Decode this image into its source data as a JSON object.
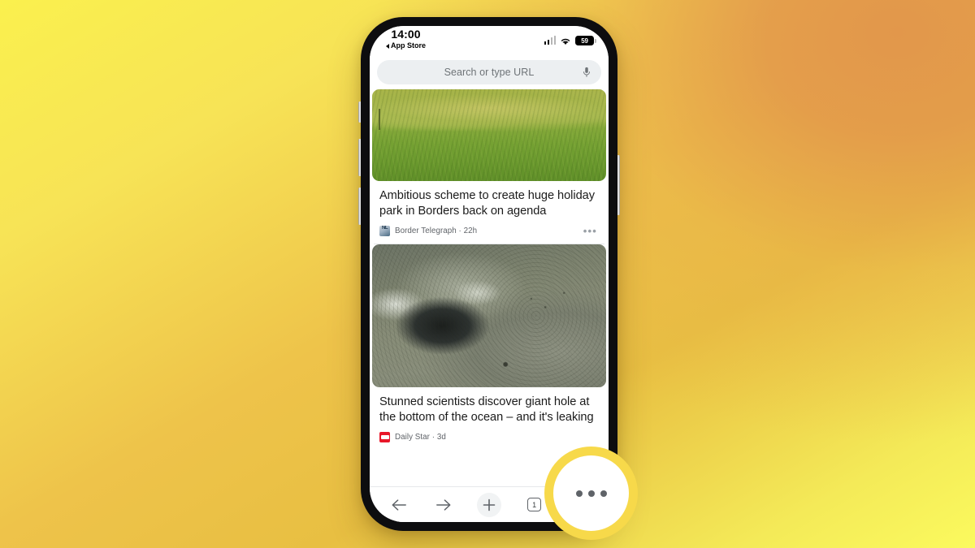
{
  "background": {
    "gradient_from": "#faf04e",
    "gradient_mid": "#e8bf42",
    "gradient_accent": "#e2974b",
    "gradient_to": "#fbfa5e"
  },
  "phone": {
    "status_bar": {
      "time": "14:00",
      "back_app_label": "App Store",
      "battery_percent": "59",
      "signal_icon": "cellular-bars-icon",
      "wifi_icon": "wifi-icon",
      "battery_icon": "battery-icon"
    },
    "omnibox": {
      "placeholder": "Search or type URL",
      "value": "",
      "mic_icon": "microphone-icon"
    },
    "feed": {
      "cards": [
        {
          "image_name": "grass-field-photo",
          "title": "Ambitious scheme to create huge holiday park in Borders back on agenda",
          "source": "Border Telegraph",
          "time_ago": "22h",
          "meta": "Border Telegraph · 22h",
          "favicon_name": "border-telegraph-favicon",
          "more_icon": "overflow-menu-icon"
        },
        {
          "image_name": "ocean-floor-hole-photo",
          "title": "Stunned scientists discover giant hole at the bottom of the ocean – and it's leaking",
          "source": "Daily Star",
          "time_ago": "3d",
          "meta": "Daily Star · 3d",
          "favicon_name": "daily-star-favicon",
          "more_icon": "overflow-menu-icon"
        }
      ]
    },
    "toolbar": {
      "back_icon": "arrow-left-icon",
      "forward_icon": "arrow-right-icon",
      "new_tab_icon": "plus-icon",
      "tab_count": "1",
      "menu_icon": "three-dots-icon"
    }
  },
  "highlight": {
    "target": "three-dots-menu-button",
    "ring_color": "#f7d94a"
  }
}
